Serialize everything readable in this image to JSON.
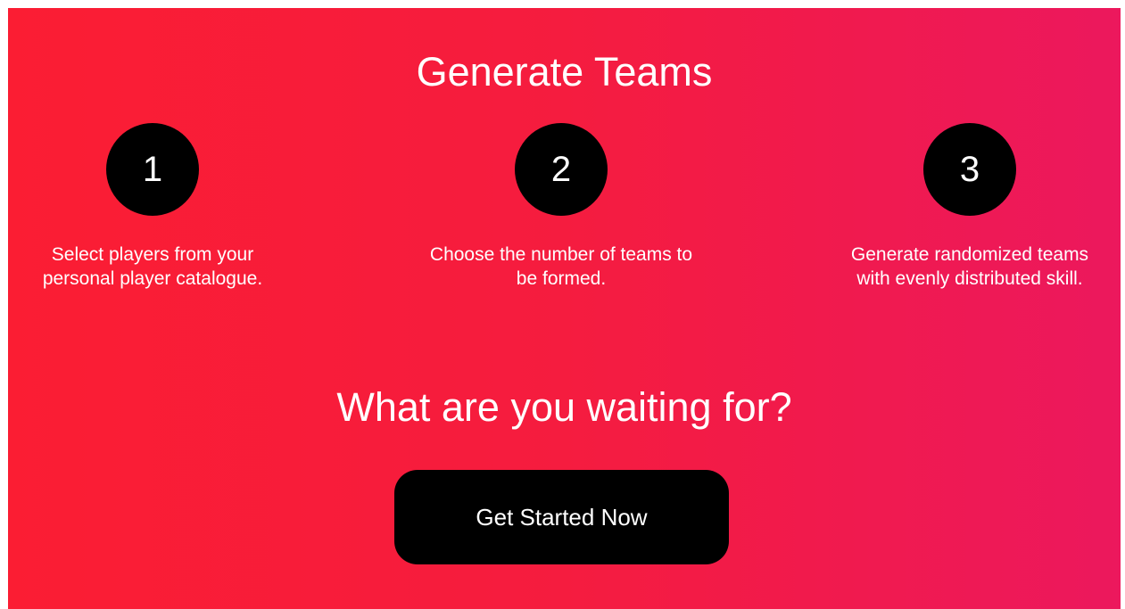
{
  "hero": {
    "title": "Generate Teams",
    "colors": {
      "gradient_start": "#fb1d33",
      "gradient_end": "#ec185d",
      "circle": "#000000",
      "text": "#ffffff"
    }
  },
  "steps": [
    {
      "number": "1",
      "text": "Select players from your personal player catalogue."
    },
    {
      "number": "2",
      "text": "Choose the number of teams to be formed."
    },
    {
      "number": "3",
      "text": "Generate randomized teams with evenly distributed skill."
    }
  ],
  "cta": {
    "question": "What are you waiting for?",
    "button_label": "Get Started Now"
  }
}
